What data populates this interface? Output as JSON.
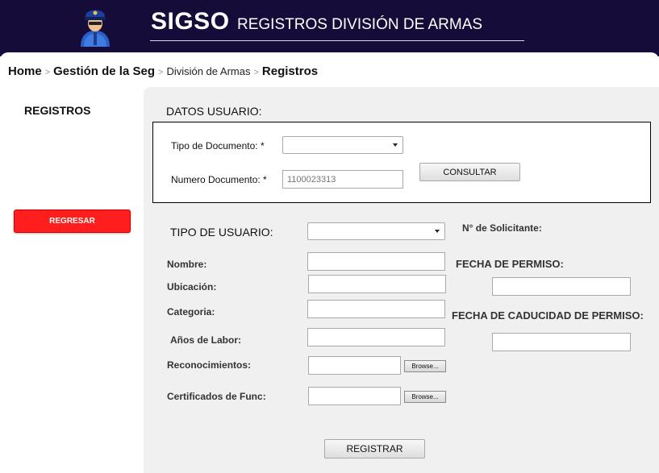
{
  "header": {
    "app_name": "SIGSO",
    "subtitle": "REGISTROS DIVISIÓN DE ARMAS"
  },
  "breadcrumb": [
    "Home",
    "Gestión de la Seg",
    "División de Armas",
    "Registros"
  ],
  "sidebar": {
    "title": "REGISTROS",
    "back_button": "REGRESAR"
  },
  "datos_usuario": {
    "title": "DATOS USUARIO:",
    "tipo_documento_label": "Tipo de Documento: *",
    "tipo_documento_value": "",
    "numero_documento_label": "Numero Documento: *",
    "numero_documento_placeholder": "1100023313",
    "consultar_button": "CONSULTAR"
  },
  "form": {
    "tipo_usuario_label": "TIPO DE  USUARIO:",
    "tipo_usuario_value": "",
    "nombre_label": "Nombre:",
    "ubicacion_label": "Ubicación:",
    "categoria_label": "Categoria:",
    "anos_labor_label": "Años de Labor:",
    "reconocimientos_label": "Reconocimientos:",
    "certificados_label": "Certificados de Func:",
    "browse_label": "Browse...",
    "solicitante_label": "N° de Solicitante:",
    "fecha_permiso_label": "FECHA DE PERMISO:",
    "fecha_caducidad_label": "FECHA DE CADUCIDAD DE PERMISO:",
    "registrar_button": "REGISTRAR"
  },
  "colors": {
    "header_bg": "#150c3a",
    "back_button_bg": "#ff1e1e",
    "panel_bg": "#f0f0f0"
  }
}
